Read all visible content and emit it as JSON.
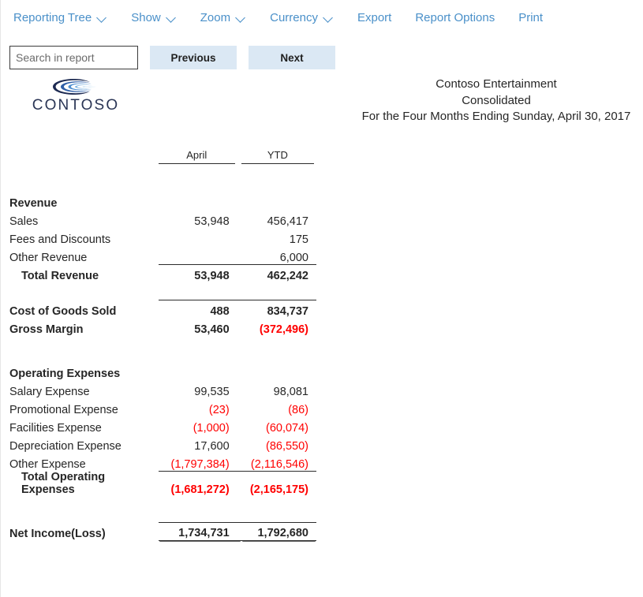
{
  "toolbar": {
    "items": [
      {
        "label": "Reporting Tree",
        "name": "reporting-tree",
        "caret": true
      },
      {
        "label": "Show",
        "name": "show",
        "caret": true
      },
      {
        "label": "Zoom",
        "name": "zoom",
        "caret": true
      },
      {
        "label": "Currency",
        "name": "currency",
        "caret": true
      },
      {
        "label": "Export",
        "name": "export",
        "caret": false
      },
      {
        "label": "Report Options",
        "name": "report-options",
        "caret": false
      },
      {
        "label": "Print",
        "name": "print",
        "caret": false
      }
    ],
    "link_color": "#4a90c9"
  },
  "search": {
    "placeholder": "Search in report",
    "value": "",
    "previous_label": "Previous",
    "next_label": "Next",
    "button_color": "#dbe8f4"
  },
  "logo": {
    "wordmark": "CONTOSO",
    "mark_icon": "contoso-swoosh-icon",
    "mark_colors": [
      "#1d2a52",
      "#2f5fa8",
      "#4f8fd0",
      "#7fb6e4",
      "#bcdcf2"
    ]
  },
  "report_header": {
    "line1": "Contoso Entertainment",
    "line2": "Consolidated",
    "line3": "For the Four Months Ending Sunday, April 30, 2017"
  },
  "statement": {
    "columns": [
      "",
      "April",
      "YTD"
    ],
    "negative_color": "#ff0000",
    "rows": [
      {
        "kind": "section",
        "label": "Revenue",
        "april": "",
        "ytd": ""
      },
      {
        "kind": "line",
        "label": "Sales",
        "april": "53,948",
        "ytd": "456,417"
      },
      {
        "kind": "line",
        "label": "Fees and Discounts",
        "april": "",
        "ytd": "175"
      },
      {
        "kind": "line",
        "label": "Other Revenue",
        "april": "",
        "ytd": "6,000",
        "rule": "below"
      },
      {
        "kind": "total",
        "label": "Total Revenue",
        "april": "53,948",
        "ytd": "462,242"
      },
      {
        "kind": "spacer"
      },
      {
        "kind": "subtotal",
        "label": "Cost of Goods Sold",
        "april": "488",
        "ytd": "834,737",
        "rule": "above"
      },
      {
        "kind": "subtotal",
        "label": "Gross Margin",
        "april": "53,460",
        "ytd": "(372,496)",
        "ytd_neg": true
      },
      {
        "kind": "spacer-lg"
      },
      {
        "kind": "section",
        "label": "Operating Expenses",
        "april": "",
        "ytd": ""
      },
      {
        "kind": "line",
        "label": "Salary Expense",
        "april": "99,535",
        "ytd": "98,081"
      },
      {
        "kind": "line",
        "label": "Promotional Expense",
        "april": "(23)",
        "ytd": "(86)",
        "april_neg": true,
        "ytd_neg": true
      },
      {
        "kind": "line",
        "label": "Facilities Expense",
        "april": "(1,000)",
        "ytd": "(60,074)",
        "april_neg": true,
        "ytd_neg": true
      },
      {
        "kind": "line",
        "label": "Depreciation Expense",
        "april": "17,600",
        "ytd": "(86,550)",
        "ytd_neg": true
      },
      {
        "kind": "line",
        "label": "Other Expense",
        "april": "(1,797,384)",
        "ytd": "(2,116,546)",
        "april_neg": true,
        "ytd_neg": true,
        "rule": "below"
      },
      {
        "kind": "total",
        "label": "Total Operating Expenses",
        "april": "(1,681,272)",
        "ytd": "(2,165,175)",
        "april_neg": true,
        "ytd_neg": true
      },
      {
        "kind": "spacer-lg"
      },
      {
        "kind": "grand",
        "label": "Net Income(Loss)",
        "april": "1,734,731",
        "ytd": "1,792,680"
      }
    ]
  }
}
